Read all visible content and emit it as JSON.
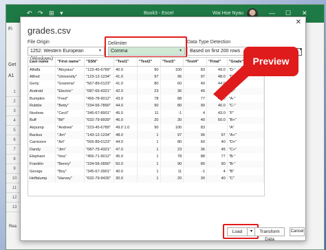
{
  "excel": {
    "title": "Book3 - Excel",
    "user": "Wai Hoe Nyau",
    "quick_access": "↶ ↷ ⊞ ▾",
    "ribbon_letters": [
      "Fi",
      "Get",
      "A1"
    ],
    "row_numbers": [
      "1",
      "2",
      "3",
      "4",
      "5",
      "6",
      "7",
      "8",
      "9",
      "10",
      "11",
      "12",
      "13"
    ],
    "status": "Rea"
  },
  "dialog": {
    "file_name": "grades.csv",
    "file_origin": {
      "label": "File Origin",
      "value": "1252: Western European (Windows)"
    },
    "delimiter": {
      "label": "Delimiter",
      "value": "Comma"
    },
    "detection": {
      "label": "Data Type Detection",
      "value": "Based on first 200 rows"
    }
  },
  "table": {
    "headers": [
      "Last name",
      "\"First name\"",
      "\"SSN\"",
      "\"Test1\"",
      "\"Test2\"",
      "\"Test3\"",
      "\"Test4\"",
      "\"Final\"",
      "\"Grade\""
    ],
    "rows": [
      [
        "Alfalfa",
        "\"Aloysius\"",
        "\"123-45-6789\"",
        "40.0",
        "90",
        "100",
        "83",
        "49.0",
        "\"D-\""
      ],
      [
        "Alfred",
        "\"University\"",
        "\"123-12-1234\"",
        "41.0",
        "97",
        "96",
        "97",
        "48.0",
        "\"D+\""
      ],
      [
        "Gerty",
        "\"Gramma\"",
        "\"567-89-0123\"",
        "41.0",
        "80",
        "60",
        "40",
        "44.0",
        "\"C\""
      ],
      [
        "Android",
        "\"Electric\"",
        "\"087-65-4321\"",
        "42.0",
        "23",
        "36",
        "45",
        "47.0",
        "\"B-\""
      ],
      [
        "Bumpkin",
        "\"Fred\"",
        "\"456-78-9012\"",
        "43.0",
        "78",
        "88",
        "77",
        "45.0",
        "\"A-\""
      ],
      [
        "Rubble",
        "\"Betty\"",
        "\"234-56-7890\"",
        "44.0",
        "90",
        "80",
        "90",
        "46.0",
        "\"C-\""
      ],
      [
        "Noshow",
        "\"Cecil\"",
        "\"345-67-8901\"",
        "45.0",
        "11",
        "-1",
        "4",
        "43.0",
        "\"F\""
      ],
      [
        "Buff",
        "\"Bif\"",
        "\"632-79-9939\"",
        "46.0",
        "20",
        "30",
        "40",
        "50.0",
        "\"B+\""
      ],
      [
        "Airpump",
        "\"Andrew\"",
        "\"223-45-6789\"",
        "49.0 1.0",
        "90",
        "100",
        "83",
        "",
        "\"A\""
      ],
      [
        "Backus",
        "\"Jim\"",
        "\"143-12-1234\"",
        "48.0",
        "1",
        "97",
        "96",
        "97",
        "\"A+\""
      ],
      [
        "Carnivore",
        "\"Art\"",
        "\"565-89-0123\"",
        "44.0",
        "1",
        "80",
        "60",
        "40",
        "\"D+\""
      ],
      [
        "Dandy",
        "\"Jim\"",
        "\"087-75-4321\"",
        "47.0",
        "1",
        "23",
        "36",
        "45",
        "\"C+\""
      ],
      [
        "Elephant",
        "\"Ima\"",
        "\"456-71-9012\"",
        "45.0",
        "1",
        "78",
        "88",
        "77",
        "\"B-\""
      ],
      [
        "Franklin",
        "\"Benny\"",
        "\"234-56-2890\"",
        "50.0",
        "1",
        "90",
        "80",
        "90",
        "\"B-\""
      ],
      [
        "George",
        "\"Boy\"",
        "\"345-67-3901\"",
        "40.0",
        "1",
        "11",
        "-1",
        "4",
        "\"B\""
      ],
      [
        "Heffalump",
        "\"Harvey\"",
        "\"632-79-9439\"",
        "30.0",
        "1",
        "20",
        "30",
        "40",
        "\"C\""
      ]
    ]
  },
  "callout": {
    "text": "Preview"
  },
  "buttons": {
    "load": "Load",
    "transform": "Transform Data",
    "cancel": "Cancel"
  },
  "colors": {
    "excel_green": "#1e7a45",
    "highlight_red": "#e01b1b",
    "delimiter_bg": "#cfe9d4"
  }
}
